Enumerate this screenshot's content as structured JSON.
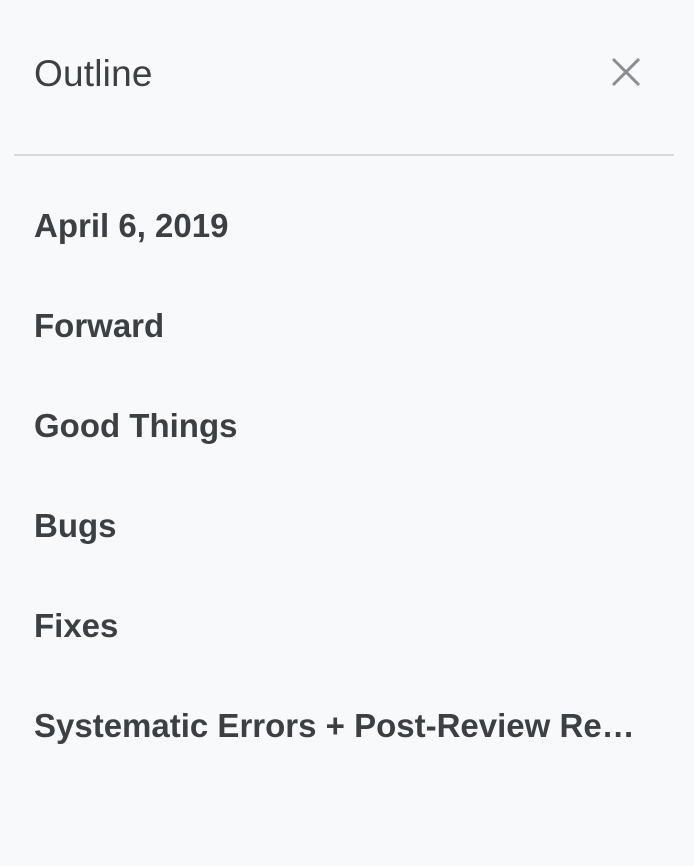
{
  "panel": {
    "title": "Outline",
    "close_icon": "close-icon"
  },
  "outline": {
    "items": [
      {
        "label": "April 6, 2019"
      },
      {
        "label": "Forward"
      },
      {
        "label": "Good Things"
      },
      {
        "label": "Bugs"
      },
      {
        "label": "Fixes"
      },
      {
        "label": "Systematic Errors + Post-Review Reflections"
      }
    ]
  }
}
